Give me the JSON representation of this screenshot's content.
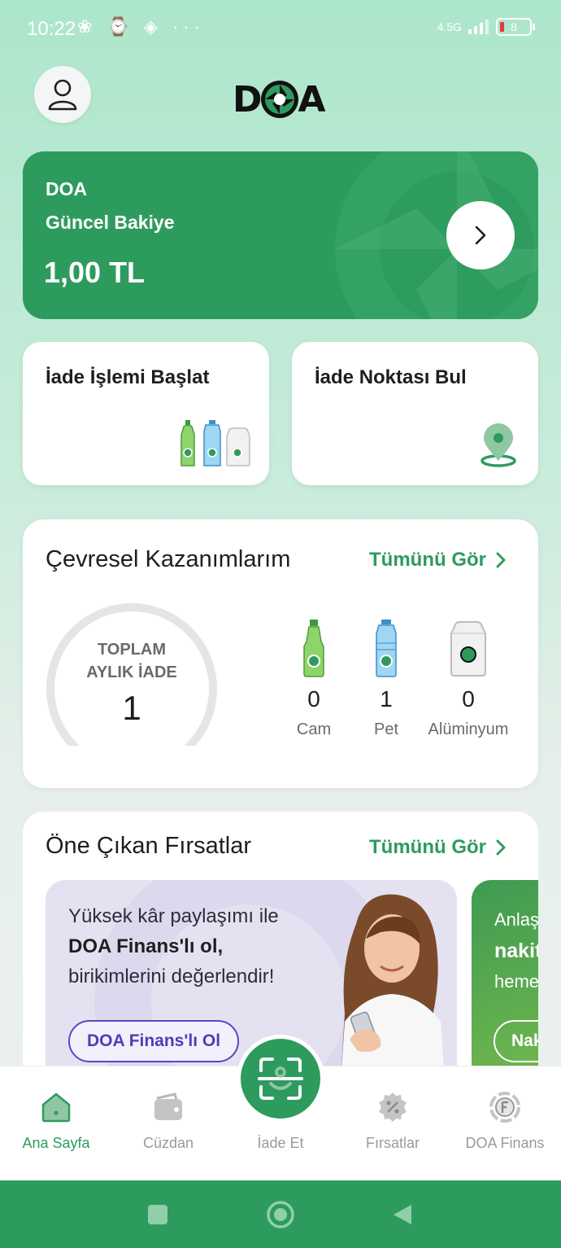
{
  "status_bar": {
    "time": "10:22",
    "left_icons": "❀ ⌚ ◈ ···",
    "network": "4.5G",
    "battery": "8"
  },
  "header": {
    "logo_text_left": "D",
    "logo_text_right": "A",
    "profile_icon": "user-icon"
  },
  "balance": {
    "brand": "DOA",
    "label": "Güncel Bakiye",
    "amount": "1,00 TL"
  },
  "actions": [
    {
      "label": "İade İşlemi Başlat",
      "icon": "bottles-icon"
    },
    {
      "label": "İade Noktası Bul",
      "icon": "location-pin-icon"
    }
  ],
  "environment": {
    "title": "Çevresel Kazanımlarım",
    "see_all": "Tümünü Gör",
    "gauge_label_line1": "TOPLAM",
    "gauge_label_line2": "AYLIK İADE",
    "gauge_value": "1",
    "materials": [
      {
        "name": "Cam",
        "count": "0"
      },
      {
        "name": "Pet",
        "count": "1"
      },
      {
        "name": "Alüminyum",
        "count": "0"
      }
    ],
    "colors": {
      "accent": "#2e9b5e",
      "track": "#e5e5e5"
    }
  },
  "opportunities": {
    "title": "Öne Çıkan Fırsatlar",
    "see_all": "Tümünü Gör",
    "promo1": {
      "line1": "Yüksek kâr paylaşımı ile",
      "line2": "DOA Finans'lı ol,",
      "line3": "birikimlerini değerlendir!",
      "button": "DOA Finans'lı Ol"
    },
    "promo2": {
      "line1": "Anlaş",
      "line2": "nakit",
      "line3": "heme",
      "button": "Nak"
    }
  },
  "bottom_nav": [
    {
      "label": "Ana Sayfa",
      "icon": "home-icon",
      "active": true
    },
    {
      "label": "Cüzdan",
      "icon": "wallet-icon",
      "active": false
    },
    {
      "label": "İade Et",
      "icon": "scan-icon",
      "active": false
    },
    {
      "label": "Fırsatlar",
      "icon": "discount-badge-icon",
      "active": false
    },
    {
      "label": "DOA Finans",
      "icon": "finance-coin-icon",
      "active": false
    }
  ],
  "system_nav": [
    "recent-apps-icon",
    "home-circle-icon",
    "back-icon"
  ]
}
